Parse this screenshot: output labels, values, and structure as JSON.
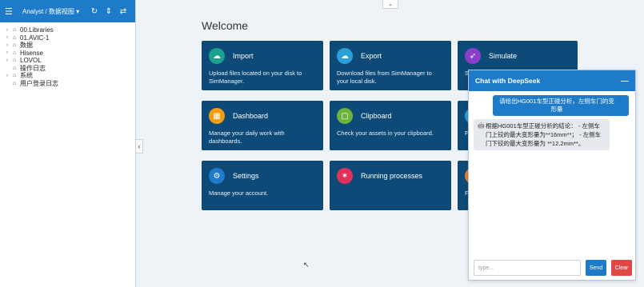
{
  "sidebar": {
    "title": "Analyst / 数据视图",
    "menu_icon": "hamburger-icon",
    "tree": [
      {
        "label": "00.Libraries",
        "expandable": true
      },
      {
        "label": "01.AVIC-1",
        "expandable": true
      },
      {
        "label": "数据",
        "expandable": true
      },
      {
        "label": "Hisense",
        "expandable": true
      },
      {
        "label": "LOVOL",
        "expandable": true
      },
      {
        "label": "操作日志",
        "expandable": false
      },
      {
        "label": "系统",
        "expandable": true
      },
      {
        "label": "用户登录日志",
        "expandable": false
      }
    ]
  },
  "main": {
    "welcome": "Welcome",
    "cards": [
      {
        "name": "Import",
        "desc": "Upload files located on your disk to SimManager.",
        "color": "#1aa08f"
      },
      {
        "name": "Export",
        "desc": "Download files from SimManager to your local disk.",
        "color": "#2b9fd6"
      },
      {
        "name": "Simulate",
        "desc": "S",
        "color": "#8a3fc7"
      },
      {
        "name": "Dashboard",
        "desc": "Manage your daily work with dashboards.",
        "color": "#f39c12"
      },
      {
        "name": "Clipboard",
        "desc": "Check your assets in your clipboard.",
        "color": "#6cb33f"
      },
      {
        "name": "",
        "desc": "F d",
        "color": "#2b9fd6"
      },
      {
        "name": "Settings",
        "desc": "Manage your account.",
        "color": "#1e7bc9"
      },
      {
        "name": "Running processes",
        "desc": "",
        "color": "#e0315a"
      },
      {
        "name": "",
        "desc": "F",
        "color": "#f07a2a"
      }
    ]
  },
  "chat": {
    "title": "Chat with DeepSeek",
    "minimize": "—",
    "user_message": "请给出HG001车型正碰分析，左侧车门的变形量",
    "bot_message": "根据HG001车型正碰分析的结论： - 左侧车门上铰的最大变形量为**16mm**； - 左侧车门下铰的最大变形量为 **12.2mm**。",
    "input_placeholder": "type...",
    "send_label": "Send",
    "clear_label": "Clear"
  }
}
